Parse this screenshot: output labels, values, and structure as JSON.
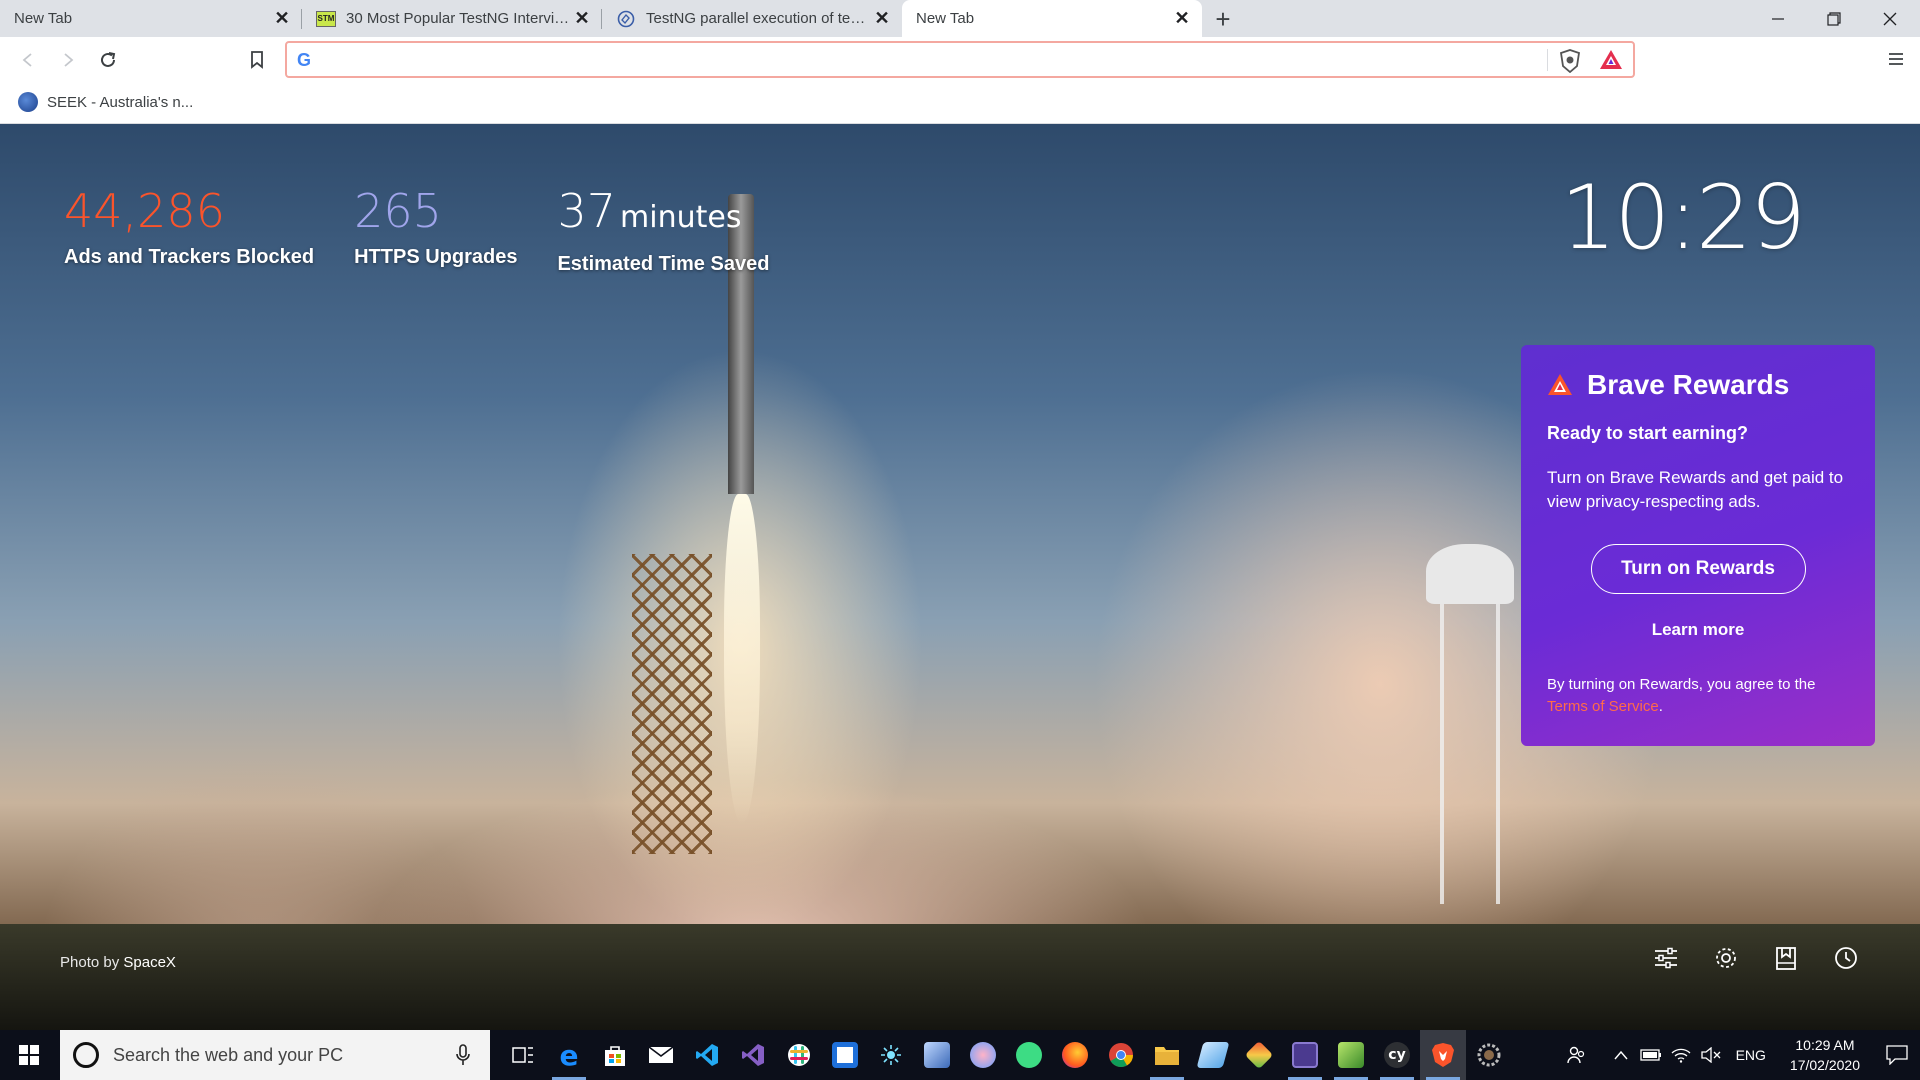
{
  "tabs": [
    {
      "title": "New Tab",
      "favicon": "none",
      "active": false
    },
    {
      "title": "30 Most Popular TestNG Interview",
      "favicon": "stm-icon",
      "active": false
    },
    {
      "title": "TestNG parallel execution of tests,",
      "favicon": "page-icon",
      "active": false
    },
    {
      "title": "New Tab",
      "favicon": "none",
      "active": true
    }
  ],
  "stm_favicon_text": "STM",
  "omnibox": {
    "value": "",
    "search_engine_icon": "G"
  },
  "bookmarks": [
    {
      "label": "SEEK - Australia's n..."
    }
  ],
  "ntp": {
    "stats": [
      {
        "value": "44,286",
        "unit": "",
        "label": "Ads and Trackers Blocked",
        "color": "#fb542b"
      },
      {
        "value": "265",
        "unit": "",
        "label": "HTTPS Upgrades",
        "color": "#a0a5eb"
      },
      {
        "value": "37",
        "unit": "minutes",
        "label": "Estimated Time Saved",
        "color": "#ffffff"
      }
    ],
    "clock": "10:29",
    "rewards": {
      "title": "Brave Rewards",
      "subtitle": "Ready to start earning?",
      "description": "Turn on Brave Rewards and get paid to view privacy-respecting ads.",
      "button": "Turn on Rewards",
      "learn_more": "Learn more",
      "terms_prefix": "By turning on Rewards, you agree to the",
      "terms_link": "Terms of Service",
      "terms_suffix": "."
    },
    "photo_credit_prefix": "Photo by",
    "photo_credit_name": "SpaceX"
  },
  "taskbar": {
    "search_placeholder": "Search the web and your PC",
    "language": "ENG",
    "time": "10:29 AM",
    "date": "17/02/2020",
    "cypress_label": "cy"
  },
  "colors": {
    "accent": "#fb542b",
    "rewards_bg": "#6b2bd6"
  }
}
